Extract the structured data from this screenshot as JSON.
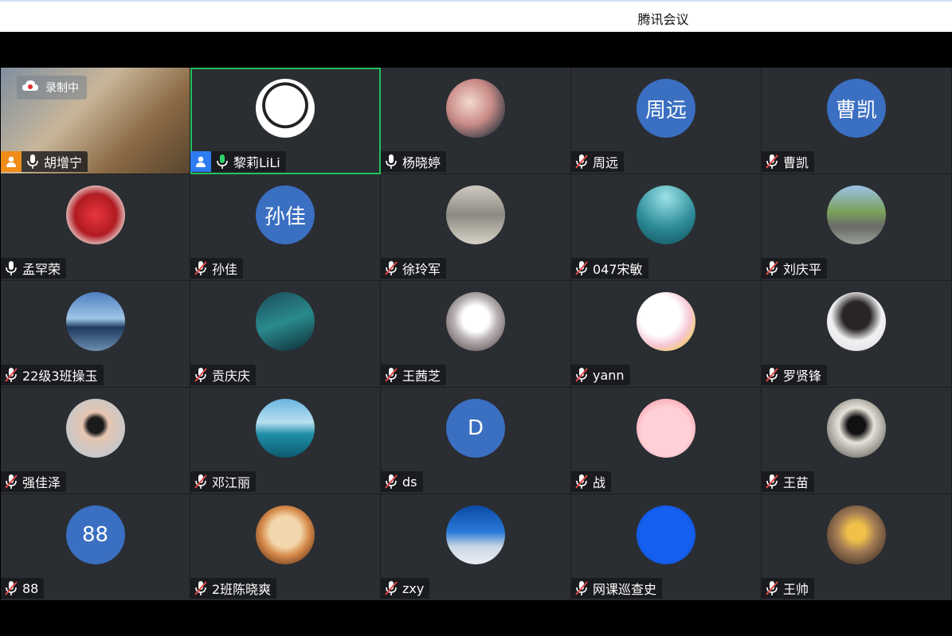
{
  "window": {
    "title": "腾讯会议"
  },
  "recording": {
    "label": "录制中"
  },
  "colors": {
    "active_speaker_border": "#1fc05e",
    "avatar_bg": "#3a6fc2",
    "tile_bg": "#2a2d31",
    "muted_icon": "#e04848"
  },
  "participants": [
    {
      "name": "胡增宁",
      "mic": "on",
      "badge": "host",
      "avatar_type": "video"
    },
    {
      "name": "黎莉LiLi",
      "mic": "speaking",
      "badge": "cohost",
      "avatar_type": "image",
      "active": true
    },
    {
      "name": "杨晓婷",
      "mic": "on",
      "avatar_type": "image"
    },
    {
      "name": "周远",
      "mic": "muted",
      "avatar_type": "text",
      "avatar_text": "周远"
    },
    {
      "name": "曹凯",
      "mic": "muted",
      "avatar_type": "text",
      "avatar_text": "曹凯"
    },
    {
      "name": "孟罕荣",
      "mic": "on",
      "avatar_type": "image"
    },
    {
      "name": "孙佳",
      "mic": "muted",
      "avatar_type": "text",
      "avatar_text": "孙佳"
    },
    {
      "name": "徐玲军",
      "mic": "muted",
      "avatar_type": "image"
    },
    {
      "name": "047宋敏",
      "mic": "muted",
      "avatar_type": "image"
    },
    {
      "name": "刘庆平",
      "mic": "muted",
      "avatar_type": "image"
    },
    {
      "name": "22级3班操玉",
      "mic": "muted",
      "avatar_type": "image"
    },
    {
      "name": "贡庆庆",
      "mic": "muted",
      "avatar_type": "image"
    },
    {
      "name": "王茜芝",
      "mic": "muted",
      "avatar_type": "image"
    },
    {
      "name": "yann",
      "mic": "muted",
      "avatar_type": "image"
    },
    {
      "name": "罗贤锋",
      "mic": "muted",
      "avatar_type": "image"
    },
    {
      "name": "强佳泽",
      "mic": "muted",
      "avatar_type": "image"
    },
    {
      "name": "邓江丽",
      "mic": "muted",
      "avatar_type": "image"
    },
    {
      "name": "ds",
      "mic": "muted",
      "avatar_type": "text",
      "avatar_text": "D"
    },
    {
      "name": "战",
      "mic": "muted",
      "avatar_type": "image"
    },
    {
      "name": "王苗",
      "mic": "muted",
      "avatar_type": "image"
    },
    {
      "name": "88",
      "mic": "muted",
      "avatar_type": "text",
      "avatar_text": "88"
    },
    {
      "name": "2班陈晓爽",
      "mic": "muted",
      "avatar_type": "image"
    },
    {
      "name": "zxy",
      "mic": "muted",
      "avatar_type": "image"
    },
    {
      "name": "网课巡查史",
      "mic": "muted",
      "avatar_type": "image"
    },
    {
      "name": "王帅",
      "mic": "muted",
      "avatar_type": "image"
    }
  ]
}
